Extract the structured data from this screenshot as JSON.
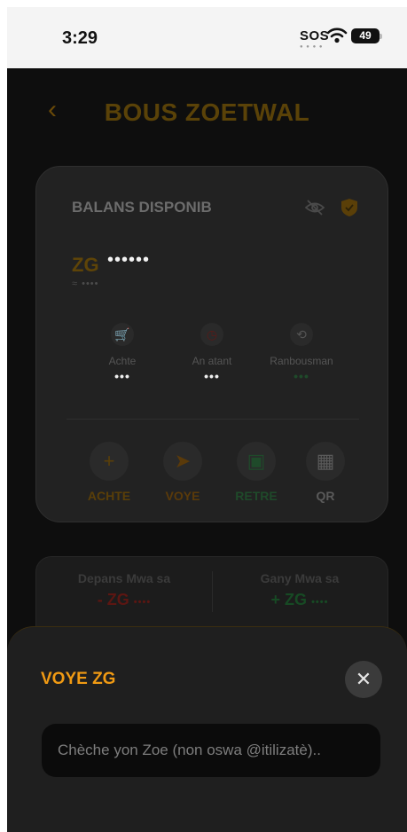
{
  "status_bar": {
    "time": "3:29",
    "sos": "SOS",
    "battery": "49"
  },
  "header": {
    "back_icon": "chevron-left-icon",
    "title": "BOUS ZOETWAL"
  },
  "balance_card": {
    "label": "BALANS DISPONIB",
    "currency": "ZG",
    "masked_amount": "••••••",
    "masked_sub": "≈ ••••",
    "stats": [
      {
        "icon": "cart-icon",
        "label": "Achte",
        "value": "•••"
      },
      {
        "icon": "clock-icon",
        "label": "An atant",
        "value": "•••"
      },
      {
        "icon": "refund-icon",
        "label": "Ranbousman",
        "value": "•••"
      }
    ],
    "actions": [
      {
        "icon": "plus-icon",
        "label": "ACHTE"
      },
      {
        "icon": "send-icon",
        "label": "VOYE"
      },
      {
        "icon": "withdraw-icon",
        "label": "RETRE"
      },
      {
        "icon": "qr-code-icon",
        "label": "QR"
      }
    ]
  },
  "summary": {
    "spend_label": "Depans Mwa sa",
    "spend_value": "- ZG",
    "spend_mask": "••••",
    "gain_label": "Gany Mwa sa",
    "gain_value": "+ ZG",
    "gain_mask": "••••"
  },
  "sheet": {
    "title": "VOYE ZG",
    "close_icon": "close-icon",
    "search_placeholder": "Chèche yon Zoe (non oswa @itilizatè).."
  },
  "colors": {
    "accent": "#f09a13",
    "danger": "#d0342c",
    "success": "#2e9e4a"
  }
}
